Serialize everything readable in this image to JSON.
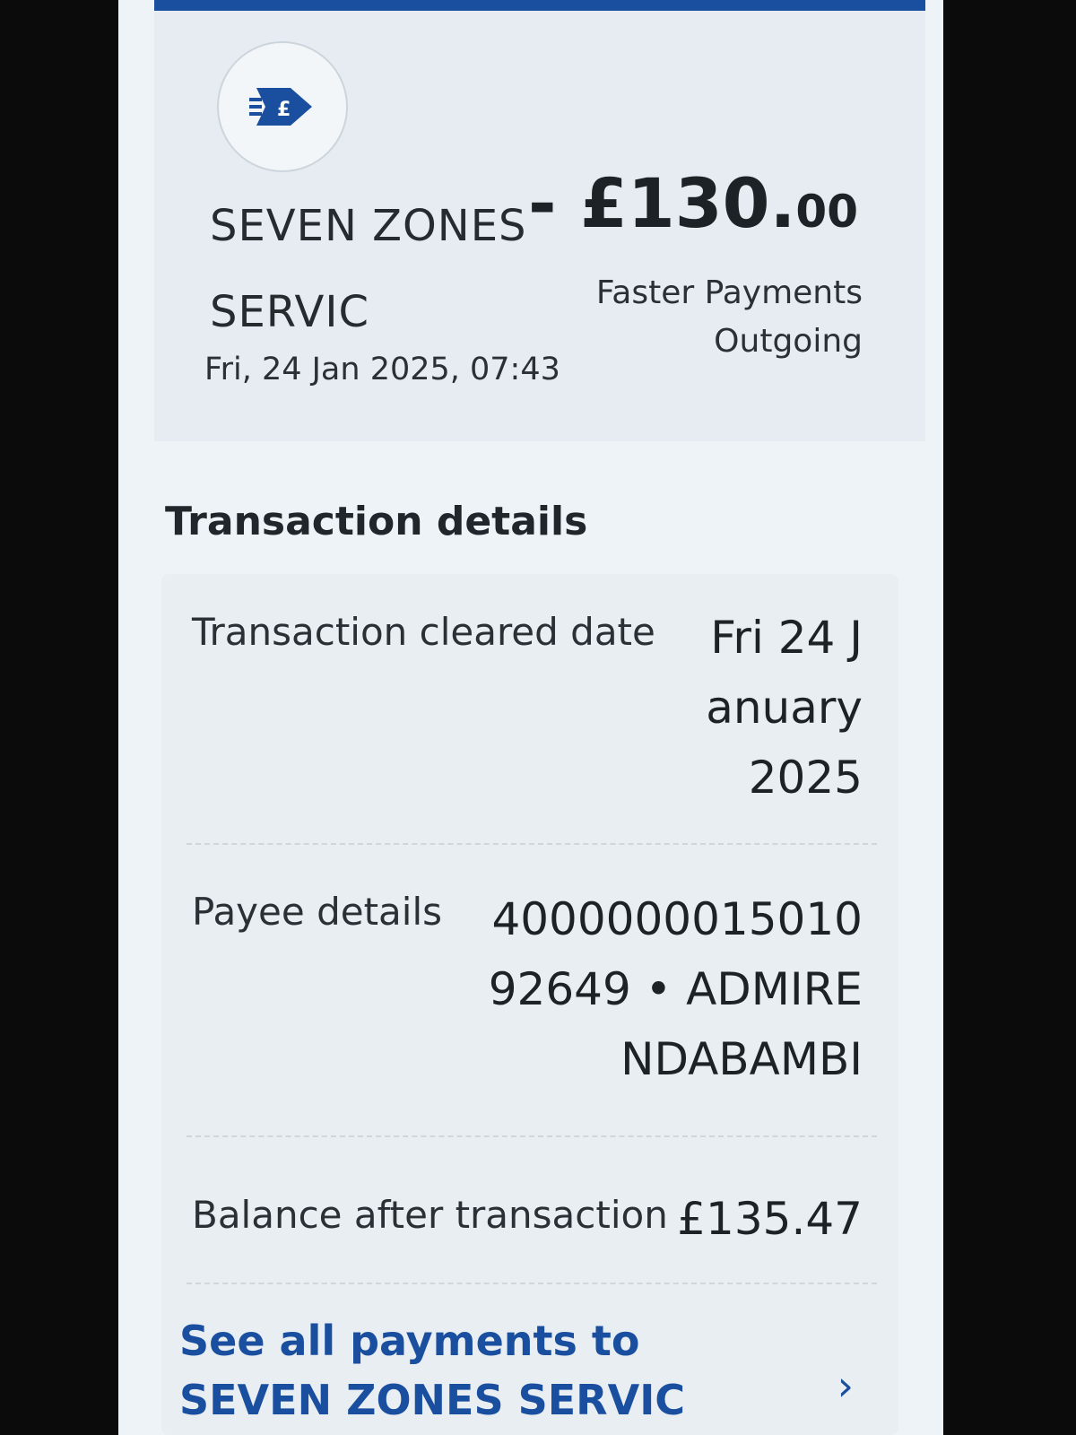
{
  "header": {
    "logo_icon": "bank-transfer-pound-icon",
    "merchant_name": "SEVEN ZONES SERVIC",
    "datetime": "Fri, 24 Jan 2025, 07:43",
    "amount_main": "- £130.",
    "amount_pence": "00",
    "payment_type": "Faster Payments Outgoing"
  },
  "details": {
    "title": "Transaction details",
    "cleared_date_label": "Transaction cleared date",
    "cleared_date_value": "Fri 24 January 2025",
    "payee_label": "Payee details",
    "payee_value": "400000001501092649 • ADMIRE NDABAMBI",
    "balance_label": "Balance after transaction",
    "balance_value": "£135.47"
  },
  "footer": {
    "see_all_label": "See all payments to SEVEN ZONES SERVIC",
    "chevron_icon": "chevron-right-icon"
  },
  "colors": {
    "brand_blue": "#1a4fa0",
    "background": "#eef3f7",
    "text": "#1d2226"
  }
}
